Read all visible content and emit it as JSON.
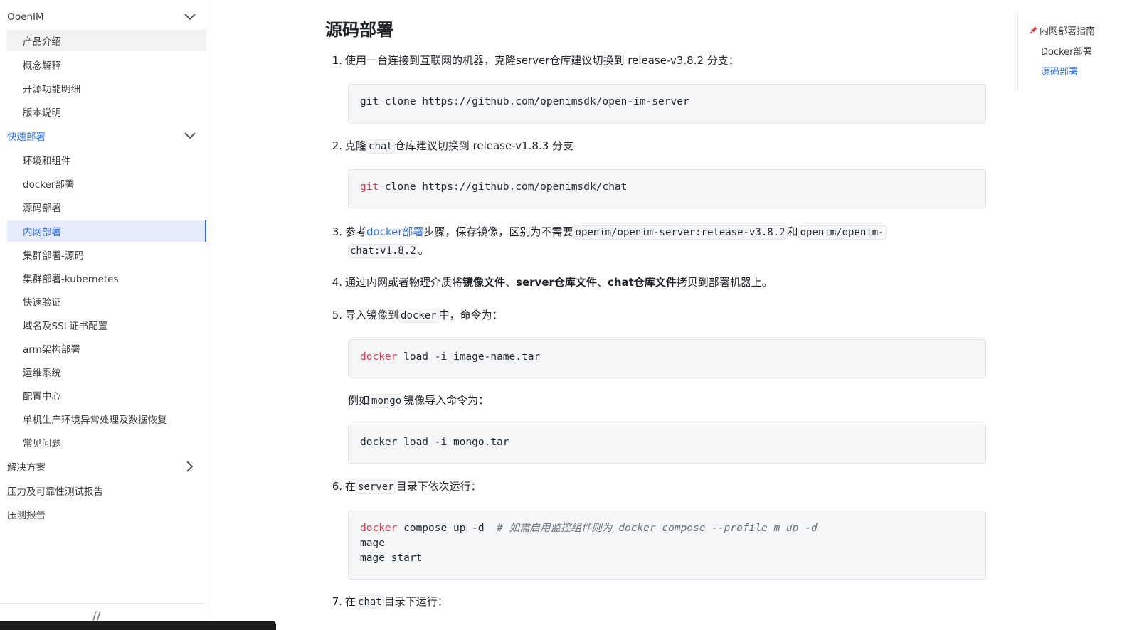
{
  "sidebar": {
    "items": [
      {
        "label": "OpenIM",
        "level": 1,
        "chevron": "chevron-down"
      },
      {
        "label": "产品介绍",
        "level": 2,
        "state": "hover"
      },
      {
        "label": "概念解释",
        "level": 2
      },
      {
        "label": "开源功能明细",
        "level": 2
      },
      {
        "label": "版本说明",
        "level": 2
      },
      {
        "label": "快速部署",
        "level": 1,
        "chevron": "chevron-down",
        "color": "#2f6fec"
      },
      {
        "label": "环境和组件",
        "level": 2
      },
      {
        "label": "docker部署",
        "level": 2
      },
      {
        "label": "源码部署",
        "level": 2
      },
      {
        "label": "内网部署",
        "level": 2,
        "state": "active"
      },
      {
        "label": "集群部署-源码",
        "level": 2
      },
      {
        "label": "集群部署-kubernetes",
        "level": 2
      },
      {
        "label": "快速验证",
        "level": 2
      },
      {
        "label": "域名及SSL证书配置",
        "level": 2
      },
      {
        "label": "arm架构部署",
        "level": 2
      },
      {
        "label": "运维系统",
        "level": 2
      },
      {
        "label": "配置中心",
        "level": 2
      },
      {
        "label": "单机生产环境异常处理及数据恢复",
        "level": 2
      },
      {
        "label": "常见问题",
        "level": 2
      },
      {
        "label": "解决方案",
        "level": 1,
        "chevron": "chevron-right"
      },
      {
        "label": "压力及可靠性测试报告",
        "level": 1
      },
      {
        "label": "压测报告",
        "level": 1
      }
    ]
  },
  "main": {
    "title": "源码部署",
    "steps": {
      "s1": {
        "num": "1.",
        "text": "使用一台连接到互联网的机器，克隆server仓库建议切换到 release-v3.8.2 分支："
      },
      "s2": {
        "num": "2.",
        "pre": "克隆",
        "code": "chat",
        "post": "仓库建议切换到 release-v1.8.3 分支"
      },
      "s3": {
        "num": "3.",
        "pre": "参考",
        "link": "docker部署",
        "mid": "步骤，保存镜像，区别为不需要",
        "code1": "openim/openim-server:release-v3.8.2",
        "and": "和",
        "code2a": "openim/openim-",
        "code2b": "chat:v1.8.2",
        "end": "。"
      },
      "s4": {
        "num": "4.",
        "pre": "通过内网或者物理介质将",
        "b1": "镜像文件",
        "sep1": "、",
        "b2": "server仓库文件",
        "sep2": "、",
        "b3": "chat仓库文件",
        "post": "拷贝到部署机器上。"
      },
      "s5": {
        "num": "5.",
        "pre": "导入镜像到",
        "code": "docker",
        "post": "中，命令为："
      },
      "s5b": {
        "pre": "例如",
        "code": "mongo",
        "post": "镜像导入命令为："
      },
      "s6": {
        "num": "6.",
        "pre": "在",
        "code": "server",
        "post": "目录下依次运行："
      },
      "s7": {
        "num": "7.",
        "pre": "在",
        "code": "chat",
        "post": "目录下运行："
      }
    },
    "code": {
      "c1": {
        "line": "git clone https://github.com/openimsdk/open-im-server"
      },
      "c2": {
        "kw": "git",
        "rest": " clone https://github.com/openimsdk/chat"
      },
      "c3": {
        "kw": "docker",
        "rest": " load -i image-name.tar"
      },
      "c4": {
        "line": "docker load -i mongo.tar"
      },
      "c5": {
        "kw": "docker",
        "rest": " compose up -d  ",
        "comment": "# 如需启用监控组件则为 docker compose --profile m up -d",
        "line2": "mage",
        "line3": "mage start"
      }
    }
  },
  "toc": {
    "items": [
      {
        "label": "内网部署指南",
        "icon": "pin"
      },
      {
        "label": "Docker部署"
      },
      {
        "label": "源码部署",
        "active": true
      }
    ]
  }
}
